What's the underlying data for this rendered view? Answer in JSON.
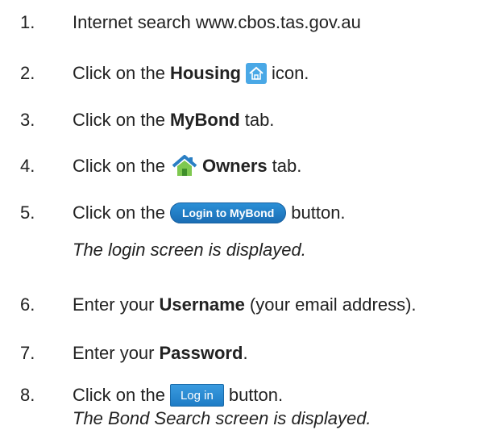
{
  "steps": [
    {
      "num": "1.",
      "pre": "Internet search www.cbos.tas.gov.au"
    },
    {
      "num": "2.",
      "pre": "Click on the",
      "bold": "Housing",
      "icon": "housing-icon",
      "post": "icon."
    },
    {
      "num": "3.",
      "pre": "Click on the",
      "bold": "MyBond",
      "post": "tab."
    },
    {
      "num": "4.",
      "pre": "Click on the",
      "icon": "house-icon",
      "bold": "Owners",
      "post": "tab."
    },
    {
      "num": "5.",
      "pre": "Click on the",
      "button": "Login to MyBond",
      "post": "button."
    },
    {
      "num": "6.",
      "pre": "Enter your",
      "bold": "Username",
      "post": "(your email address)."
    },
    {
      "num": "7.",
      "pre": "Enter your",
      "bold": "Password",
      "post": "."
    },
    {
      "num": "8.",
      "pre": "Click on the",
      "button": "Log in",
      "post": "button."
    }
  ],
  "notes": {
    "after_step_5": "The login screen is displayed.",
    "after_step_8": "The Bond Search screen is displayed."
  },
  "colors": {
    "text": "#222222",
    "button_blue": "#1b6eb5",
    "housing_icon_bg": "#4aa8e6",
    "owners_icon_roof": "#2a7fc4"
  }
}
